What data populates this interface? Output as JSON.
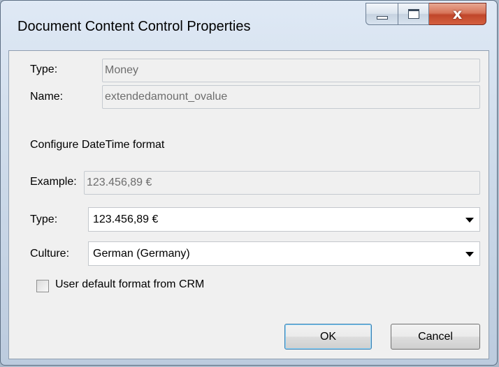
{
  "window": {
    "title": "Document Content Control  Properties",
    "controls": {
      "minimize_icon": "minimize-icon",
      "maximize_icon": "maximize-icon",
      "close_icon": "close-icon",
      "close_glyph": "x"
    }
  },
  "fields": {
    "type_label": "Type:",
    "type_value": "Money",
    "name_label": "Name:",
    "name_value": "extendedamount_ovalue"
  },
  "section_heading": "Configure DateTime format",
  "format": {
    "example_label": "Example:",
    "example_value": "123.456,89 €",
    "type_label": "Type:",
    "type_selected": "123.456,89 €",
    "culture_label": "Culture:",
    "culture_selected": "German (Germany)"
  },
  "checkbox": {
    "label": "User default format from CRM",
    "checked": false
  },
  "buttons": {
    "ok": "OK",
    "cancel": "Cancel"
  },
  "colors": {
    "titlebar": "#cfdceb",
    "close_button": "#c0462a",
    "dialog_background": "#f0f0f0",
    "default_button_border": "#3c7fb1"
  }
}
